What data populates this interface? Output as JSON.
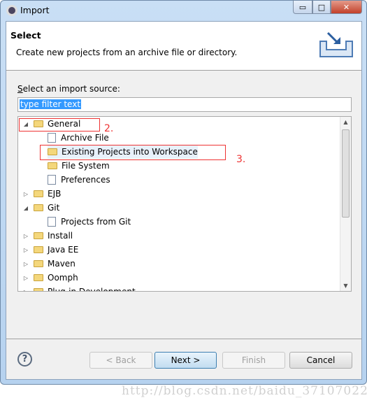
{
  "window": {
    "title": "Import",
    "minimize": "▭",
    "maximize": "□",
    "close": "✕"
  },
  "header": {
    "title": "Select",
    "description": "Create new projects from an archive file or directory."
  },
  "source_label_mnemonic": "S",
  "source_label_rest": "elect an import source:",
  "filter": {
    "value": "type filter text"
  },
  "tree": [
    {
      "label": "General",
      "level": 0,
      "expanded": true,
      "icon": "folder-icon"
    },
    {
      "label": "Archive File",
      "level": 1,
      "icon": "archive-icon"
    },
    {
      "label": "Existing Projects into Workspace",
      "level": 1,
      "icon": "folder-open-icon",
      "selected": true
    },
    {
      "label": "File System",
      "level": 1,
      "icon": "folder-icon"
    },
    {
      "label": "Preferences",
      "level": 1,
      "icon": "preferences-icon"
    },
    {
      "label": "EJB",
      "level": 0,
      "expanded": false,
      "icon": "folder-icon"
    },
    {
      "label": "Git",
      "level": 0,
      "expanded": true,
      "icon": "folder-icon"
    },
    {
      "label": "Projects from Git",
      "level": 1,
      "icon": "git-icon"
    },
    {
      "label": "Install",
      "level": 0,
      "expanded": false,
      "icon": "folder-icon"
    },
    {
      "label": "Java EE",
      "level": 0,
      "expanded": false,
      "icon": "folder-icon"
    },
    {
      "label": "Maven",
      "level": 0,
      "expanded": false,
      "icon": "folder-icon"
    },
    {
      "label": "Oomph",
      "level": 0,
      "expanded": false,
      "icon": "folder-icon"
    },
    {
      "label": "Plug-in Development",
      "level": 0,
      "expanded": false,
      "icon": "folder-icon"
    }
  ],
  "annotations": {
    "step2": "2.",
    "step3": "3.",
    "color": "#e33333"
  },
  "buttons": {
    "back": "< Back",
    "next": "Next >",
    "finish": "Finish",
    "cancel": "Cancel"
  },
  "watermark": "http://blog.csdn.net/baidu_37107022"
}
